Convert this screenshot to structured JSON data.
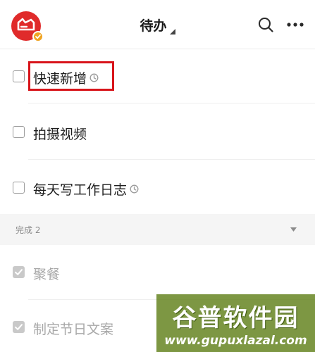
{
  "header": {
    "title": "待办",
    "avatar_icon": "app-logo-icon",
    "badge_icon": "check-badge-icon",
    "search_icon": "search-icon",
    "more_icon": "more-icon"
  },
  "todo_items": [
    {
      "label": "快速新增",
      "has_reminder": true,
      "highlighted": true
    },
    {
      "label": "拍摄视频",
      "has_reminder": false
    },
    {
      "label": "每天写工作日志",
      "has_reminder": true
    }
  ],
  "completed_section": {
    "label": "完成  2",
    "items": [
      {
        "label": "聚餐"
      },
      {
        "label": "制定节日文案"
      }
    ]
  },
  "watermark": {
    "title": "谷普软件园",
    "url": "www.gupuxlazal.com"
  },
  "colors": {
    "brand_red": "#e02b2b",
    "badge_orange": "#f0a423",
    "highlight_red": "#d8141a",
    "watermark_green": "#60801a"
  }
}
